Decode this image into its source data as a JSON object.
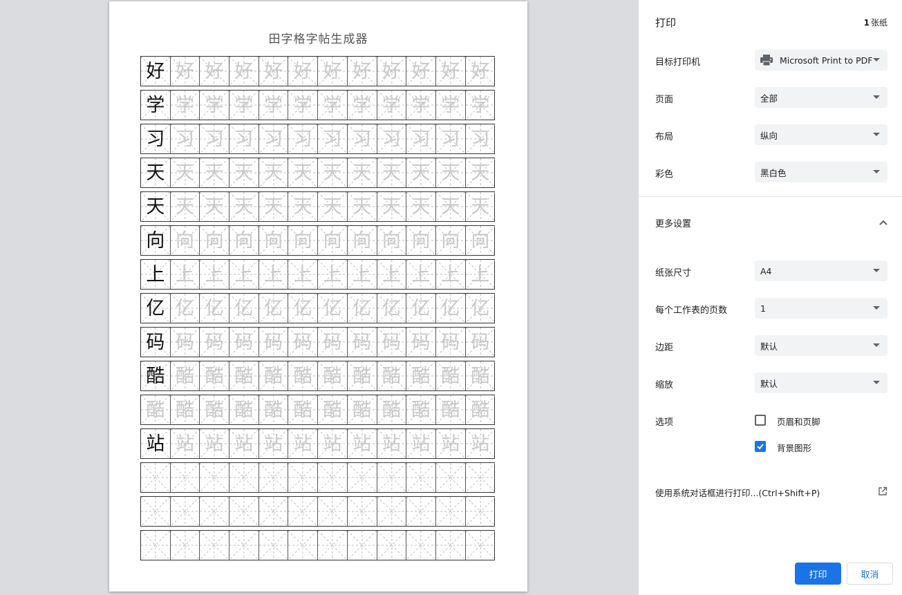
{
  "preview": {
    "sheet_title": "田字格字帖生成器",
    "rows": [
      {
        "main": "好",
        "traces": [
          "好",
          "好",
          "好",
          "好",
          "好",
          "好",
          "好",
          "好",
          "好",
          "好",
          "好"
        ]
      },
      {
        "main": "学",
        "traces": [
          "学",
          "学",
          "学",
          "学",
          "学",
          "学",
          "学",
          "学",
          "学",
          "学",
          "学"
        ]
      },
      {
        "main": "习",
        "traces": [
          "习",
          "习",
          "习",
          "习",
          "习",
          "习",
          "习",
          "习",
          "习",
          "习",
          "习"
        ]
      },
      {
        "main": "天",
        "traces": [
          "天",
          "天",
          "天",
          "天",
          "天",
          "天",
          "天",
          "天",
          "天",
          "天",
          "天"
        ]
      },
      {
        "main": "天",
        "traces": [
          "天",
          "天",
          "天",
          "天",
          "天",
          "天",
          "天",
          "天",
          "天",
          "天",
          "天"
        ]
      },
      {
        "main": "向",
        "traces": [
          "向",
          "向",
          "向",
          "向",
          "向",
          "向",
          "向",
          "向",
          "向",
          "向",
          "向"
        ]
      },
      {
        "main": "上",
        "traces": [
          "上",
          "上",
          "上",
          "上",
          "上",
          "上",
          "上",
          "上",
          "上",
          "上",
          "上"
        ]
      },
      {
        "main": "亿",
        "traces": [
          "亿",
          "亿",
          "亿",
          "亿",
          "亿",
          "亿",
          "亿",
          "亿",
          "亿",
          "亿",
          "亿"
        ]
      },
      {
        "main": "码",
        "traces": [
          "码",
          "码",
          "码",
          "码",
          "码",
          "码",
          "码",
          "码",
          "码",
          "码",
          "码"
        ]
      },
      {
        "main": "酷",
        "traces": [
          "酷",
          "酷",
          "酷",
          "酷",
          "酷",
          "酷",
          "酷",
          "酷",
          "酷",
          "酷",
          "酷"
        ]
      },
      {
        "main": "",
        "traces": [
          "酷",
          "酷",
          "酷",
          "酷",
          "酷",
          "酷",
          "酷",
          "酷",
          "酷",
          "酷",
          "酷",
          "酷"
        ]
      },
      {
        "main": "站",
        "traces": [
          "站",
          "站",
          "站",
          "站",
          "站",
          "站",
          "站",
          "站",
          "站",
          "站",
          "站"
        ]
      },
      {
        "main": "",
        "traces": []
      },
      {
        "main": "",
        "traces": []
      },
      {
        "main": "",
        "traces": []
      }
    ]
  },
  "panel": {
    "title": "打印",
    "sheet_count_number": "1",
    "sheet_count_unit": "张纸",
    "destination": {
      "label": "目标打印机",
      "value": "Microsoft Print to PDF",
      "icon": "printer-icon"
    },
    "pages": {
      "label": "页面",
      "value": "全部"
    },
    "layout": {
      "label": "布局",
      "value": "纵向"
    },
    "color": {
      "label": "彩色",
      "value": "黑白色"
    },
    "more_settings": {
      "label": "更多设置",
      "icon": "chevron-up-icon"
    },
    "paper_size": {
      "label": "纸张尺寸",
      "value": "A4"
    },
    "pages_per_sheet": {
      "label": "每个工作表的页数",
      "value": "1"
    },
    "margins": {
      "label": "边距",
      "value": "默认"
    },
    "scale": {
      "label": "缩放",
      "value": "默认"
    },
    "options": {
      "label": "选项",
      "headers_footers": {
        "label": "页眉和页脚",
        "checked": false
      },
      "background_graphics": {
        "label": "背景图形",
        "checked": true
      }
    },
    "system_dialog": {
      "label": "使用系统对话框进行打印...(Ctrl+Shift+P)",
      "icon": "open-in-new-icon"
    },
    "print_button": "打印",
    "cancel_button": "取消",
    "accent_color": "#1a73e8"
  }
}
